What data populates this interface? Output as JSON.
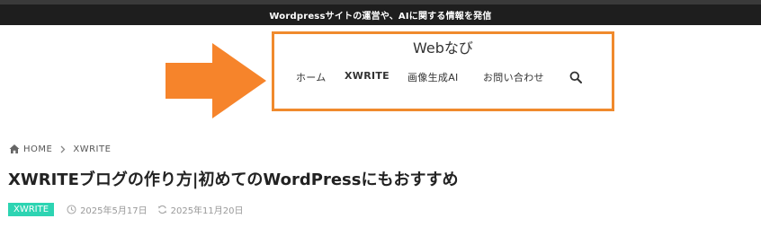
{
  "topbar": {
    "text": "Wordpressサイトの運営や、AIに関する情報を発信"
  },
  "header": {
    "site_title": "Webなび",
    "nav": [
      "ホーム",
      "XWRITE",
      "画像生成AI",
      "お問い合わせ"
    ],
    "search_icon": "search-icon"
  },
  "annotation": {
    "highlight_color": "#f08a2d",
    "arrow_color": "#f6842b"
  },
  "breadcrumb": {
    "home": "HOME",
    "current": "XWRITE"
  },
  "post": {
    "title": "XWRITEブログの作り方|初めてのWordPressにもおすすめ",
    "category": "XWRITE",
    "category_color": "#2dd4b2",
    "published": "2025年5月17日",
    "updated": "2025年11月20日"
  }
}
